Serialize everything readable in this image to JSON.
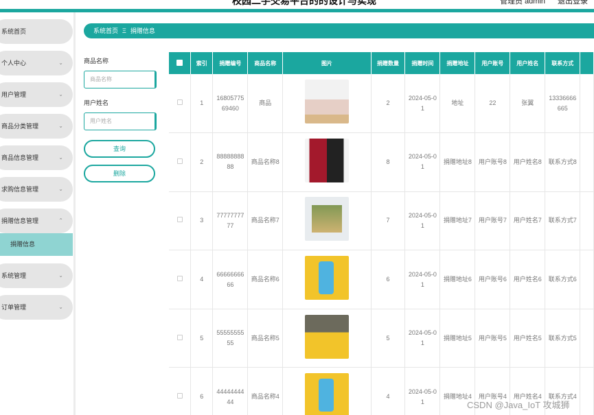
{
  "header": {
    "title": "校园二手交易平台的的设计与实现",
    "admin": "管理员 admin",
    "logout": "退出登录"
  },
  "sidebar": {
    "items": [
      {
        "label": "系统首页",
        "chev": ""
      },
      {
        "label": "个人中心",
        "chev": "⌄"
      },
      {
        "label": "用户管理",
        "chev": "⌄"
      },
      {
        "label": "商品分类管理",
        "chev": "⌄"
      },
      {
        "label": "商品信息管理",
        "chev": "⌄"
      },
      {
        "label": "求购信息管理",
        "chev": "⌄"
      },
      {
        "label": "捐赠信息管理",
        "chev": "⌃"
      },
      {
        "label": "系统管理",
        "chev": "⌄"
      },
      {
        "label": "订单管理",
        "chev": "⌄"
      }
    ],
    "active_sub": "捐赠信息"
  },
  "breadcrumb": {
    "home": "系统首页",
    "sep": "Ξ",
    "current": "捐赠信息"
  },
  "search": {
    "product_label": "商品名称",
    "product_placeholder": "商品名称",
    "user_label": "用户姓名",
    "user_placeholder": "用户姓名",
    "query_button": "查询",
    "delete_button": "删除"
  },
  "table": {
    "columns": [
      "",
      "索引",
      "捐赠编号",
      "商品名称",
      "图片",
      "捐赠数量",
      "捐赠时间",
      "捐赠地址",
      "用户账号",
      "用户姓名",
      "联系方式"
    ],
    "rows": [
      {
        "index": "1",
        "no": "1680577569460",
        "name": "商品",
        "img": "cup",
        "qty": "2",
        "time": "2024-05-01",
        "addr": "地址",
        "account": "22",
        "uname": "张翼",
        "phone": "13336666665"
      },
      {
        "index": "2",
        "no": "8888888888",
        "name": "商品名称8",
        "img": "bag",
        "qty": "8",
        "time": "2024-05-01",
        "addr": "捐赠地址8",
        "account": "用户账号8",
        "uname": "用户姓名8",
        "phone": "联系方式8"
      },
      {
        "index": "3",
        "no": "7777777777",
        "name": "商品名称7",
        "img": "box",
        "qty": "7",
        "time": "2024-05-01",
        "addr": "捐赠地址7",
        "account": "用户账号7",
        "uname": "用户姓名7",
        "phone": "联系方式7"
      },
      {
        "index": "4",
        "no": "6666666666",
        "name": "商品名称6",
        "img": "lan",
        "qty": "6",
        "time": "2024-05-01",
        "addr": "捐赠地址6",
        "account": "用户账号6",
        "uname": "用户姓名6",
        "phone": "联系方式6"
      },
      {
        "index": "5",
        "no": "5555555555",
        "name": "商品名称5",
        "img": "yel",
        "qty": "5",
        "time": "2024-05-01",
        "addr": "捐赠地址5",
        "account": "用户账号5",
        "uname": "用户姓名5",
        "phone": "联系方式5"
      },
      {
        "index": "6",
        "no": "4444444444",
        "name": "商品名称4",
        "img": "lan",
        "qty": "4",
        "time": "2024-05-01",
        "addr": "捐赠地址4",
        "account": "用户账号4",
        "uname": "用户姓名4",
        "phone": "联系方式4"
      }
    ]
  },
  "watermark": "CSDN @Java_IoT 攻城狮",
  "colors": {
    "accent": "#1ba79f",
    "active_sub_bg": "#8fd4d2"
  }
}
